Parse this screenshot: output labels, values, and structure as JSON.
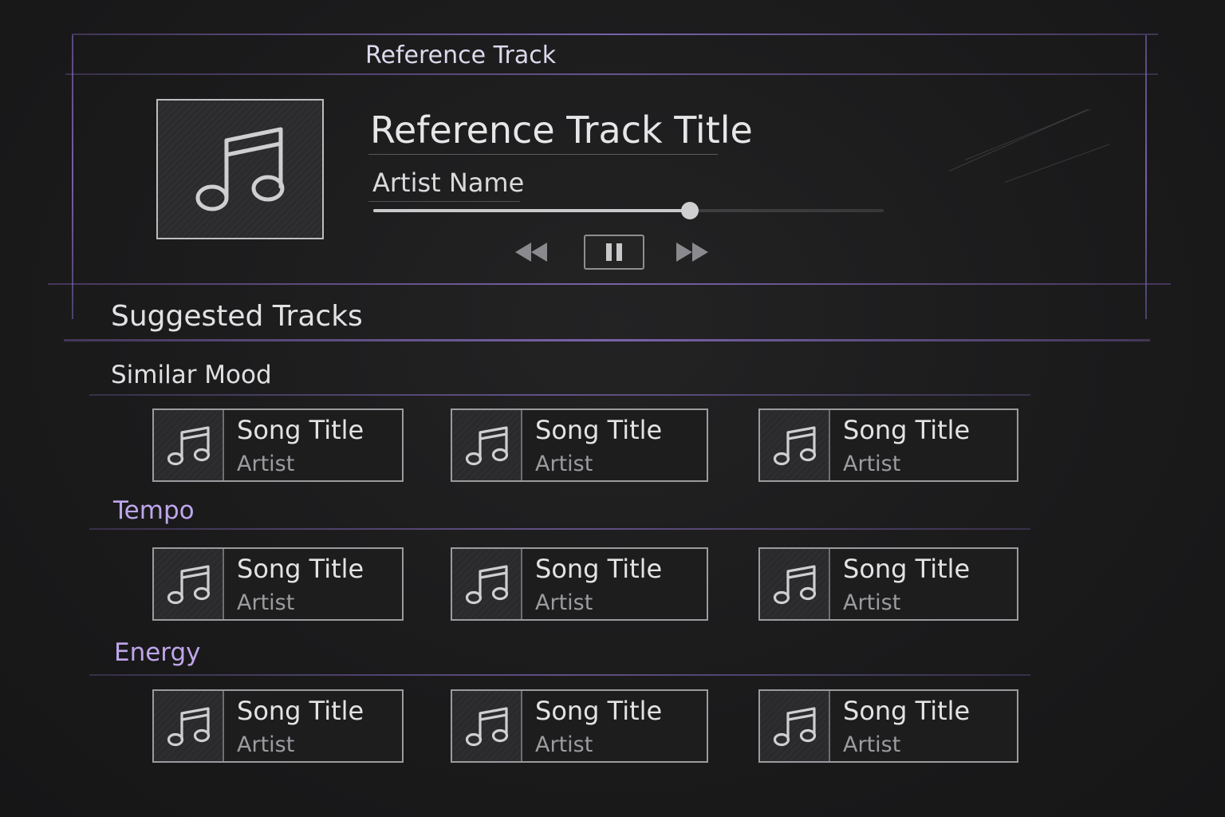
{
  "reference": {
    "header": "Reference Track",
    "title": "Reference Track Title",
    "artist": "Artist Name",
    "progress": 0.62,
    "icons": {
      "album_art": "music-note-icon",
      "rewind": "rewind-icon",
      "pause": "pause-icon",
      "forward": "fast-forward-icon"
    }
  },
  "suggested": {
    "title": "Suggested Tracks",
    "sections": [
      {
        "label": "Similar Mood",
        "color": "#e0e0e2",
        "tracks": [
          {
            "title": "Song Title",
            "artist": "Artist"
          },
          {
            "title": "Song Title",
            "artist": "Artist"
          },
          {
            "title": "Song Title",
            "artist": "Artist"
          }
        ]
      },
      {
        "label": "Tempo",
        "color": "#bfa6ea",
        "tracks": [
          {
            "title": "Song Title",
            "artist": "Artist"
          },
          {
            "title": "Song Title",
            "artist": "Artist"
          },
          {
            "title": "Song Title",
            "artist": "Artist"
          }
        ]
      },
      {
        "label": "Energy",
        "color": "#bfa6ea",
        "tracks": [
          {
            "title": "Song Title",
            "artist": "Artist"
          },
          {
            "title": "Song Title",
            "artist": "Artist"
          },
          {
            "title": "Song Title",
            "artist": "Artist"
          }
        ]
      }
    ]
  },
  "colors": {
    "accent_line": "#9678d7",
    "section_accent": "#bfa6ea",
    "background": "#1b1b1c"
  }
}
